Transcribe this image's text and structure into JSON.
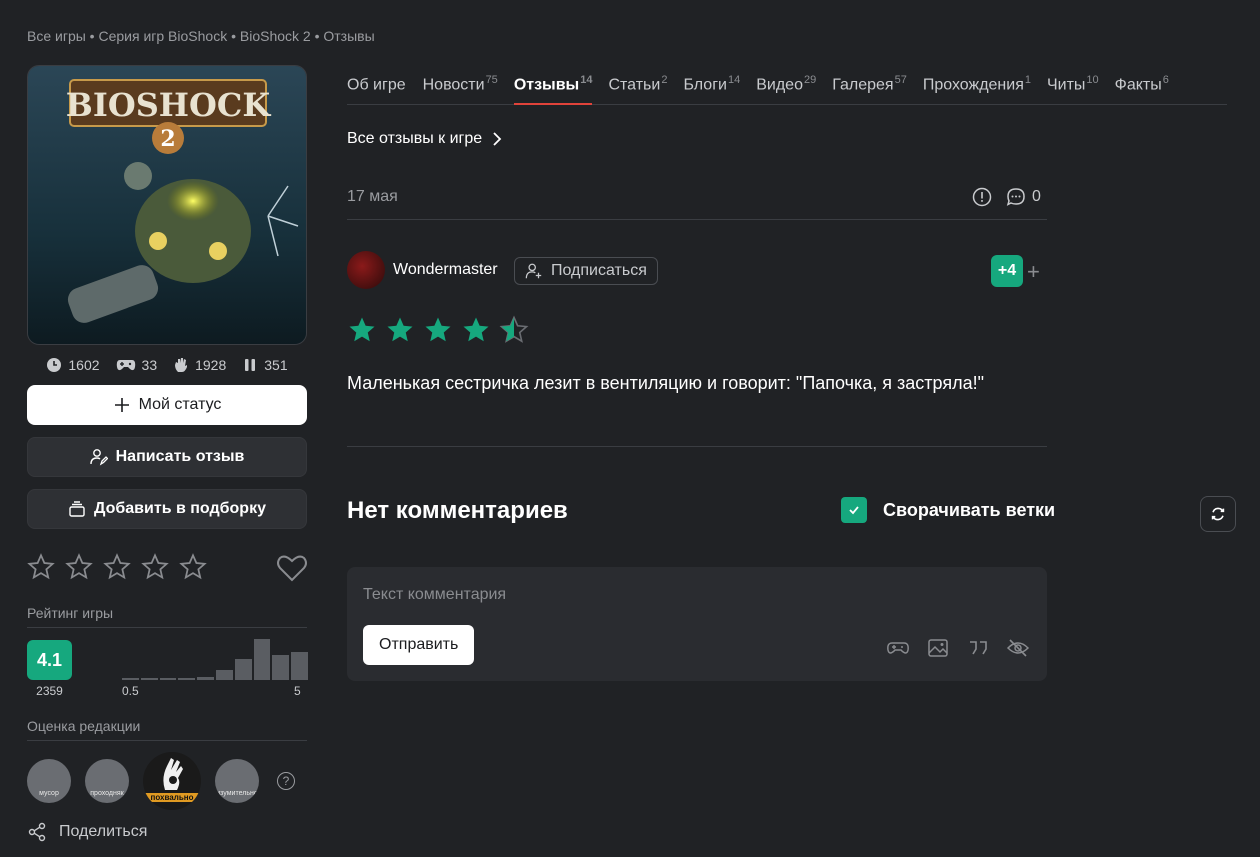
{
  "breadcrumb": "Все игры • Серия игр BioShock • BioShock 2 • Отзывы",
  "stats": {
    "clock": "1602",
    "gamepad": "33",
    "hand": "1928",
    "pause": "351"
  },
  "buttons": {
    "status": "Мой статус",
    "review": "Написать отзыв",
    "collection": "Добавить в подборку"
  },
  "rating": {
    "label": "Рейтинг игры",
    "score": "4.1",
    "count": "2359",
    "min": "0.5",
    "max": "5",
    "histogram": [
      0.04,
      0.04,
      0.04,
      0.04,
      0.06,
      0.2,
      0.42,
      0.82,
      0.5,
      0.56
    ]
  },
  "editor": {
    "label": "Оценка редакции",
    "badges": [
      "мусор",
      "проходняк",
      "похвально",
      "изумительно"
    ]
  },
  "share": "Поделиться",
  "tabs": [
    {
      "label": "Об игре",
      "count": ""
    },
    {
      "label": "Новости",
      "count": "75"
    },
    {
      "label": "Отзывы",
      "count": "14"
    },
    {
      "label": "Статьи",
      "count": "2"
    },
    {
      "label": "Блоги",
      "count": "14"
    },
    {
      "label": "Видео",
      "count": "29"
    },
    {
      "label": "Галерея",
      "count": "57"
    },
    {
      "label": "Прохождения",
      "count": "1"
    },
    {
      "label": "Читы",
      "count": "10"
    },
    {
      "label": "Факты",
      "count": "6"
    }
  ],
  "all_reviews": "Все отзывы к игре",
  "review": {
    "date": "17 мая",
    "comments": "0",
    "author": "Wondermaster",
    "subscribe": "Подписаться",
    "karma": "+4",
    "stars": 4.5,
    "text": "Маленькая сестричка лезит в вентиляцию и говорит: \"Папочка, я застряла!\""
  },
  "comments": {
    "title": "Нет комментариев",
    "collapse": "Сворачивать ветки",
    "placeholder": "Текст комментария",
    "send": "Отправить"
  },
  "colors": {
    "accent": "#16a87e",
    "tab_active": "#e0433a",
    "bg": "#202225"
  }
}
